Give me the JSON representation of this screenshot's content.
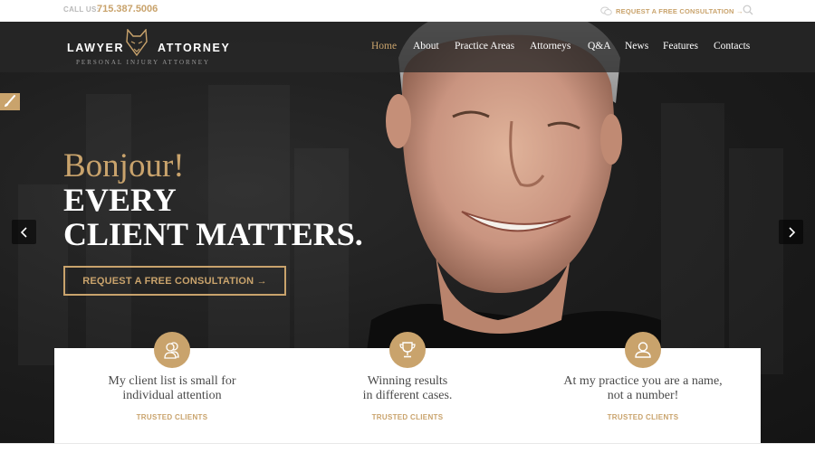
{
  "topbar": {
    "call_label": "CALL US:",
    "phone": "715.387.5006",
    "consultation_link": "REQUEST A FREE CONSULTATION →",
    "chat_icon": "chat-bubble-icon",
    "search_icon": "search-icon"
  },
  "brand": {
    "word1": "LAWYER",
    "word2": "ATTORNEY",
    "tagline": "PERSONAL INJURY ATTORNEY",
    "logo_icon": "fox-logo-icon"
  },
  "nav": {
    "items": [
      {
        "label": "Home",
        "active": true
      },
      {
        "label": "About",
        "active": false
      },
      {
        "label": "Practice Areas",
        "active": false
      },
      {
        "label": "Attorneys",
        "active": false
      },
      {
        "label": "Q&A",
        "active": false
      },
      {
        "label": "News",
        "active": false
      },
      {
        "label": "Features",
        "active": false
      },
      {
        "label": "Contacts",
        "active": false
      }
    ]
  },
  "hero": {
    "greeting": "Bonjour!",
    "headline_line1": "EVERY",
    "headline_line2": "CLIENT MATTERS.",
    "cta_label": "REQUEST A FREE CONSULTATION →",
    "prev_icon": "chevron-left-icon",
    "next_icon": "chevron-right-icon",
    "customizer_icon": "paint-brush-icon"
  },
  "features": [
    {
      "icon": "users-icon",
      "line1": "My client list is small for",
      "line2": "individual attention",
      "tag": "TRUSTED CLIENTS"
    },
    {
      "icon": "trophy-icon",
      "line1": "Winning results",
      "line2": "in different cases.",
      "tag": "TRUSTED CLIENTS"
    },
    {
      "icon": "user-icon",
      "line1": "At my practice you are a name,",
      "line2": "not a number!",
      "tag": "TRUSTED CLIENTS"
    }
  ],
  "colors": {
    "accent": "#c9a36c",
    "dark_bg": "#1d1d1d",
    "header_bg": "#282828",
    "text_dark": "#4a4a4a",
    "white": "#ffffff"
  }
}
